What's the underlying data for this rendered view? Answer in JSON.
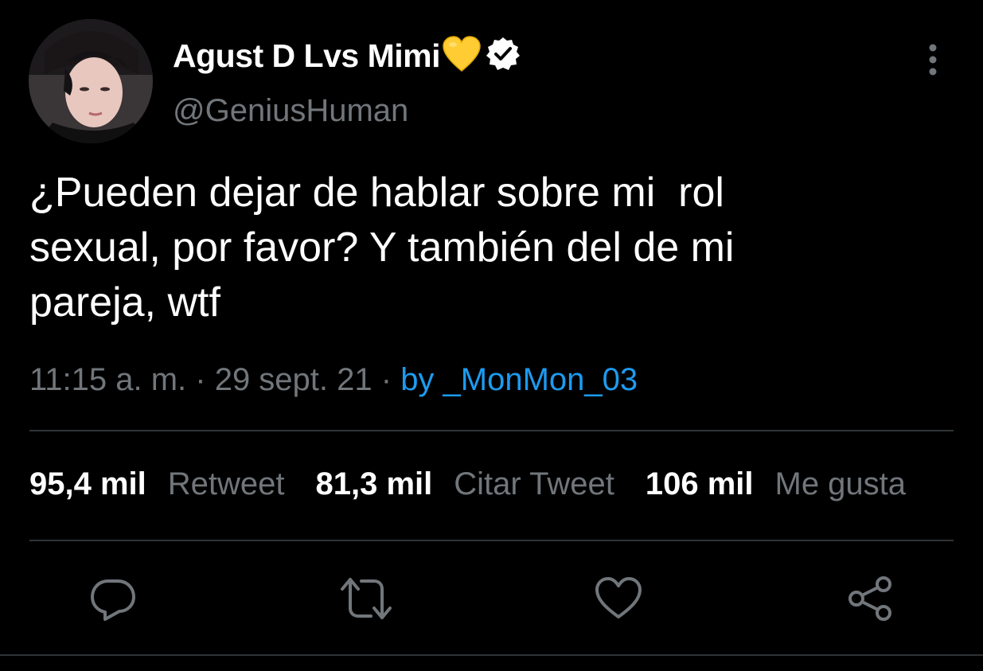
{
  "tweet": {
    "author": {
      "display_name": "Agust D Lvs Mimi",
      "handle": "@GeniusHuman",
      "emoji": "yellow-heart-emoji",
      "verified": true
    },
    "text": "¿Pueden dejar de hablar sobre mi  rol\nsexual, por favor? Y también del de mi\npareja, wtf",
    "time": "11:15 a. m.",
    "separator": " · ",
    "date": "29 sept. 21",
    "source": "by _MonMon_03"
  },
  "stats": {
    "retweets_count": "95,4 mil",
    "retweets_label": "Retweet",
    "quotes_count": "81,3 mil",
    "quotes_label": "Citar Tweet",
    "likes_count": "106 mil",
    "likes_label": "Me gusta"
  },
  "actions": [
    "reply-icon",
    "retweet-icon",
    "like-icon",
    "share-icon"
  ],
  "colors": {
    "background": "#000000",
    "primary_text": "#ffffff",
    "secondary_text": "#71767b",
    "link": "#1d9bf0",
    "divider": "#2f3336",
    "heart": "#ffcc33"
  }
}
